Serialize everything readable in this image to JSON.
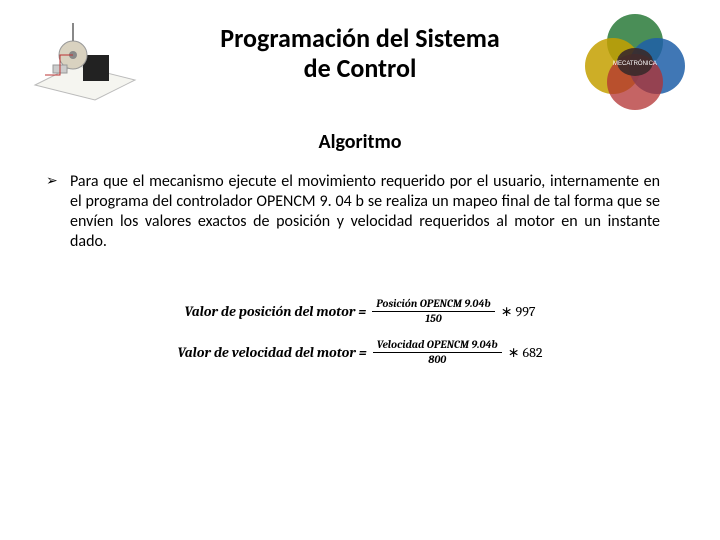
{
  "header": {
    "title_line1": "Programación del Sistema",
    "title_line2": "de Control"
  },
  "subtitle": "Algoritmo",
  "body": {
    "paragraph": "Para que el mecanismo ejecute el movimiento requerido por el usuario, internamente en el programa del controlador OPENCM 9. 04 b se realiza un mapeo final de tal forma que se envíen los valores exactos de posición y velocidad requeridos al motor en  un instante dado."
  },
  "equations": {
    "eq1_lhs": "Valor de posición del motor =",
    "eq1_num": "Posición OPENCM 9.04b",
    "eq1_den": "150",
    "eq1_mult": "∗ 997",
    "eq2_lhs": "Valor de velocidad del motor =",
    "eq2_num": "Velocidad OPENCM 9.04b",
    "eq2_den": "800",
    "eq2_mult": "∗ 682"
  },
  "images": {
    "left_alt": "mechanism-3d-illustration",
    "right_alt": "mechatronics-venn-diagram"
  }
}
